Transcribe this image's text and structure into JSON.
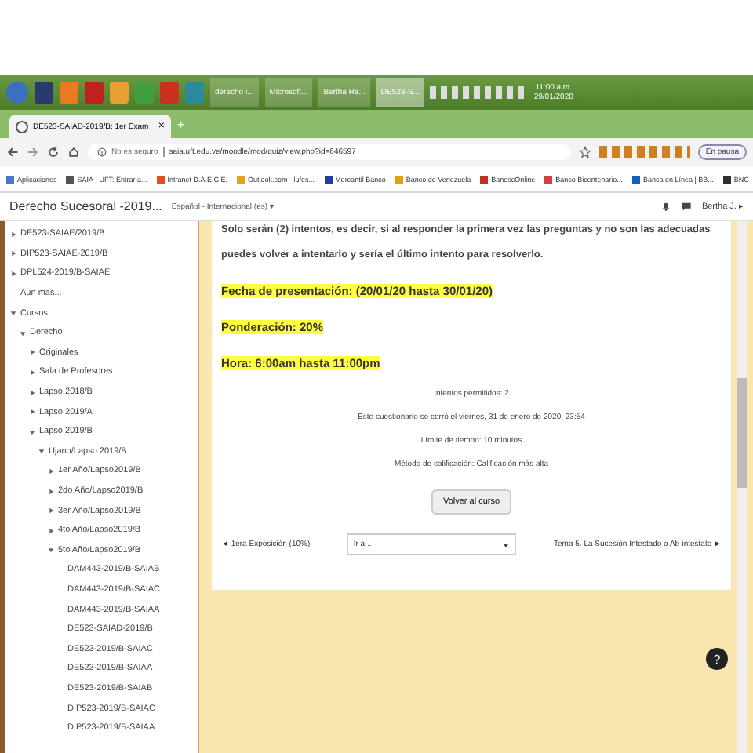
{
  "taskbar": {
    "windows": [
      {
        "label": "derecho i...",
        "selected": false
      },
      {
        "label": "Microsoft...",
        "selected": false
      },
      {
        "label": "Bertha Ra...",
        "selected": false
      },
      {
        "label": "DE523-S...",
        "selected": true
      }
    ],
    "clock": {
      "time": "11:00 a.m.",
      "date": "29/01/2020"
    }
  },
  "browser": {
    "tab": {
      "title": "DE523-SAIAD-2019/B: 1er Exam",
      "close": "×"
    },
    "new_tab": "+",
    "address": {
      "security": "No es seguro",
      "url": "saia.uft.edu.ve/moodle/mod/quiz/view.php?id=646597"
    },
    "profile": "En pausa",
    "bookmarks": [
      {
        "label": "Aplicaciones",
        "color": "#4a78c8"
      },
      {
        "label": "SAIA - UFT: Entrar a...",
        "color": "#555555"
      },
      {
        "label": "Intranet D.A.E.C.E.",
        "color": "#e05020"
      },
      {
        "label": "Outlook.com - lufes...",
        "color": "#e8a020"
      },
      {
        "label": "Mercantil Banco",
        "color": "#2040a0"
      },
      {
        "label": "Banco de Venezuela",
        "color": "#e0a010"
      },
      {
        "label": "BanescOnline",
        "color": "#c03020"
      },
      {
        "label": "Banco Bicentenario...",
        "color": "#d04040"
      },
      {
        "label": "Banca en Línea | BB...",
        "color": "#1060c0"
      },
      {
        "label": "BNC",
        "color": "#303030"
      }
    ]
  },
  "header": {
    "course": "Derecho Sucesoral -2019...",
    "language": "Español - Internacional (es) ▾",
    "user": "Bertha J. ▸"
  },
  "sidebar": {
    "items": [
      {
        "label": "DE523-SAIAE/2019/B",
        "expanded": false
      },
      {
        "label": "DIP523-SAIAE-2019/B",
        "expanded": false
      },
      {
        "label": "DPL524-2019/B-SAIAE",
        "expanded": false
      },
      {
        "label": "Aún mas..."
      },
      {
        "label": "Cursos",
        "expanded": true,
        "children": [
          {
            "label": "Derecho",
            "expanded": true,
            "children": [
              {
                "label": "Originales",
                "expanded": false
              },
              {
                "label": "Sala de Profesores",
                "expanded": false
              },
              {
                "label": "Lapso 2018/B",
                "expanded": false
              },
              {
                "label": "Lapso 2019/A",
                "expanded": false
              },
              {
                "label": "Lapso 2019/B",
                "expanded": true,
                "children": [
                  {
                    "label": "Ujano/Lapso 2019/B",
                    "expanded": true,
                    "children": [
                      {
                        "label": "1er Año/Lapso2019/B",
                        "expanded": false
                      },
                      {
                        "label": "2do Año/Lapso2019/B",
                        "expanded": false
                      },
                      {
                        "label": "3er Año/Lapso2019/B",
                        "expanded": false
                      },
                      {
                        "label": "4to Año/Lapso2019/B",
                        "expanded": false
                      },
                      {
                        "label": "5to Año/Lapso2019/B",
                        "expanded": true,
                        "children": [
                          {
                            "label": "DAM443-2019/B-SAIAB"
                          },
                          {
                            "label": "DAM443-2019/B-SAIAC"
                          },
                          {
                            "label": "DAM443-2019/B-SAIAA"
                          },
                          {
                            "label": "DE523-SAIAD-2019/B"
                          },
                          {
                            "label": "DE523-2019/B-SAIAC"
                          },
                          {
                            "label": "DE523-2019/B-SAIAA"
                          },
                          {
                            "label": "DE523-2019/B-SAIAB"
                          },
                          {
                            "label": "DIP523-2019/B-SAIAC"
                          },
                          {
                            "label": "DIP523-2019/B-SAIAA"
                          }
                        ]
                      }
                    ]
                  }
                ]
              }
            ]
          }
        ]
      }
    ]
  },
  "content": {
    "paragraphs": [
      "Solo serán (2) intentos, es  decir, si al responder la primera vez las preguntas y no son las adecuadas",
      "puedes volver a intentarlo y sería el último intento para resolverlo."
    ],
    "highlights": [
      "Fecha de presentación: (20/01/20 hasta 30/01/20)",
      "Ponderación: 20%",
      "Hora: 6:00am hasta 11:00pm"
    ],
    "info": [
      "Intentos permitidos: 2",
      "Este cuestionario se cerró el viernes, 31 de enero de 2020, 23:54",
      "Límite de tiempo: 10 minutos",
      "Método de calificación: Calificación más alta"
    ],
    "button": "Volver al curso",
    "nav": {
      "previous": "◄ 1era Exposición (10%)",
      "jump": "Ir a...",
      "next": "Tema 5. La Sucesión Intestado o Ab-intestato ►"
    }
  },
  "help_button": "?"
}
